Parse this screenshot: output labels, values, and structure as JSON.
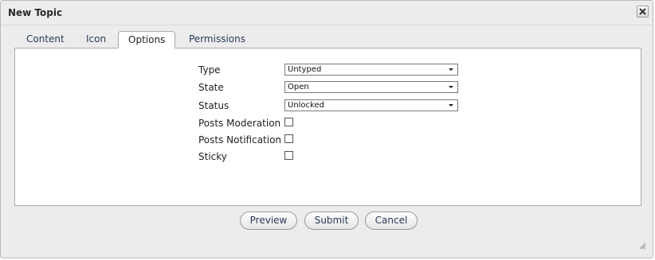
{
  "dialog": {
    "title": "New Topic"
  },
  "tabs": [
    {
      "label": "Content",
      "active": false
    },
    {
      "label": "Icon",
      "active": false
    },
    {
      "label": "Options",
      "active": true
    },
    {
      "label": "Permissions",
      "active": false
    }
  ],
  "options": {
    "type": {
      "label": "Type",
      "value": "Untyped"
    },
    "state": {
      "label": "State",
      "value": "Open"
    },
    "status": {
      "label": "Status",
      "value": "Unlocked"
    },
    "posts_moderation": {
      "label": "Posts Moderation",
      "checked": false
    },
    "posts_notification": {
      "label": "Posts Notification",
      "checked": false
    },
    "sticky": {
      "label": "Sticky",
      "checked": false
    }
  },
  "buttons": {
    "preview": "Preview",
    "submit": "Submit",
    "cancel": "Cancel"
  }
}
